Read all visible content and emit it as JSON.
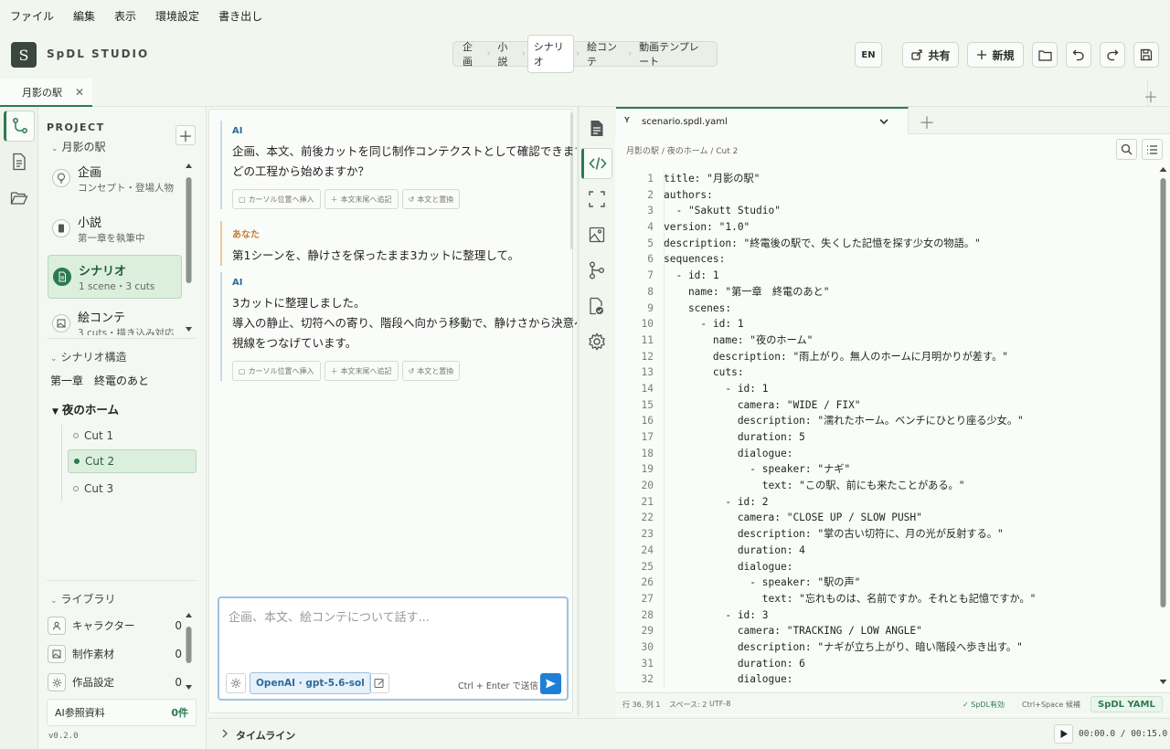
{
  "menu": [
    "ファイル",
    "編集",
    "表示",
    "環境設定",
    "書き出し"
  ],
  "header": {
    "logo_letter": "S",
    "brand": "SpDL STUDIO",
    "modes": [
      "企画",
      "小説",
      "シナリオ",
      "絵コンテ",
      "動画テンプレート"
    ],
    "active_mode": "シナリオ",
    "lang": "EN",
    "share_label": "共有",
    "new_label": "新規"
  },
  "file_tab": {
    "label": "月影の駅"
  },
  "project": {
    "title": "PROJECT",
    "name": "月影の駅",
    "stages": [
      {
        "title": "企画",
        "sub": "コンセプト・登場人物"
      },
      {
        "title": "小説",
        "sub": "第一章を執筆中"
      },
      {
        "title": "シナリオ",
        "sub": "1 scene・3 cuts"
      },
      {
        "title": "絵コンテ",
        "sub": "3 cuts・描き込み対応"
      }
    ],
    "structure_heading": "シナリオ構造",
    "sequence": "第一章　終電のあと",
    "scene": "夜のホーム",
    "cuts": [
      "Cut 1",
      "Cut 2",
      "Cut 3"
    ],
    "library_heading": "ライブラリ",
    "library": [
      {
        "label": "キャラクター",
        "count": "0"
      },
      {
        "label": "制作素材",
        "count": "0"
      },
      {
        "label": "作品設定",
        "count": "0"
      }
    ],
    "ai_refs_label": "AI参照資料",
    "ai_refs_count": "0件",
    "version": "v0.2.0"
  },
  "chat": {
    "messages": [
      {
        "role": "AI",
        "lines": [
          "企画、本文、前後カットを同じ制作コンテクストとして確認できます。",
          "どの工程から始めますか？"
        ],
        "actions": true
      },
      {
        "role": "あなた",
        "lines": [
          "第1シーンを、静けさを保ったまま3カットに整理して。"
        ],
        "actions": false
      },
      {
        "role": "AI",
        "lines": [
          "3カットに整理しました。",
          "導入の静止、切符への寄り、階段へ向かう移動で、静けさから決意へ",
          "視線をつなげています。"
        ],
        "actions": true
      }
    ],
    "actions": [
      "カーソル位置へ挿入",
      "本文末尾へ追記",
      "本文と置換"
    ],
    "placeholder": "企画、本文、絵コンテについて話す...",
    "model": "OpenAI · gpt-5.6-sol",
    "send_hint": "Ctrl + Enter で送信"
  },
  "editor": {
    "file_icon": "Y",
    "filename": "scenario.spdl.yaml",
    "breadcrumb": "月影の駅 / 夜のホーム / Cut 2",
    "lines": [
      "title: \"月影の駅\"",
      "authors:",
      "  - \"Sakutt Studio\"",
      "version: \"1.0\"",
      "description: \"終電後の駅で、失くした記憶を探す少女の物語。\"",
      "sequences:",
      "  - id: 1",
      "    name: \"第一章　終電のあと\"",
      "    scenes:",
      "      - id: 1",
      "        name: \"夜のホーム\"",
      "        description: \"雨上がり。無人のホームに月明かりが差す。\"",
      "        cuts:",
      "          - id: 1",
      "            camera: \"WIDE / FIX\"",
      "            description: \"濡れたホーム。ベンチにひとり座る少女。\"",
      "            duration: 5",
      "            dialogue:",
      "              - speaker: \"ナギ\"",
      "                text: \"この駅、前にも来たことがある。\"",
      "          - id: 2",
      "            camera: \"CLOSE UP / SLOW PUSH\"",
      "            description: \"掌の古い切符に、月の光が反射する。\"",
      "            duration: 4",
      "            dialogue:",
      "              - speaker: \"駅の声\"",
      "                text: \"忘れものは、名前ですか。それとも記憶ですか。\"",
      "          - id: 3",
      "            camera: \"TRACKING / LOW ANGLE\"",
      "            description: \"ナギが立ち上がり、暗い階段へ歩き出す。\"",
      "            duration: 6",
      "            dialogue:"
    ],
    "status": {
      "position": "行 36, 列 1",
      "indent": "スペース: 2",
      "encoding": "UTF-8",
      "valid": "✓ SpDL有効",
      "completion": "Ctrl+Space 候補",
      "language": "SpDL YAML"
    }
  },
  "timeline": {
    "label": "タイムライン",
    "time": "00:00.0 / 00:15.0"
  },
  "colors": {
    "accent": "#2c7a52",
    "ai_blue": "#2d6b9c",
    "user_orange": "#c97a2e",
    "send": "#1f7fd6"
  }
}
